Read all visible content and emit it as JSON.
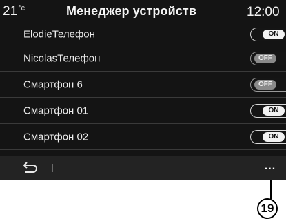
{
  "status_bar": {
    "temperature": "21",
    "temperature_unit": "°c",
    "title": "Менеджер устройств",
    "time": "12:00"
  },
  "devices": [
    {
      "name": "ElodieТелефон",
      "state": "ON",
      "on": true
    },
    {
      "name": "NicolasТелефон",
      "state": "OFF",
      "on": false
    },
    {
      "name": "Смартфон 6",
      "state": "OFF",
      "on": false
    },
    {
      "name": "Смартфон 01",
      "state": "ON",
      "on": true
    },
    {
      "name": "Смартфон 02",
      "state": "ON",
      "on": true
    }
  ],
  "bottom_bar": {
    "back_icon": "back-arrow-icon",
    "more_label": "..."
  },
  "annotation": {
    "callout_number": "19"
  },
  "colors": {
    "screen_background": "#141414",
    "bottom_bar": "#232323",
    "toggle_on": "#f2f2f2",
    "toggle_off": "#8a8a8a"
  }
}
